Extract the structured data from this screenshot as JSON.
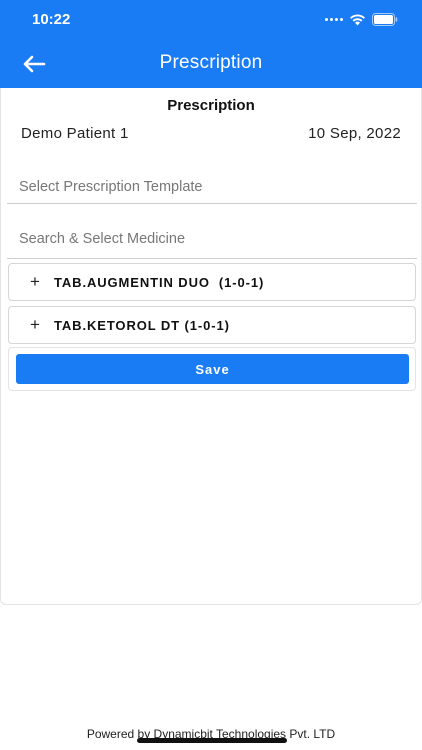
{
  "status_bar": {
    "time": "10:22"
  },
  "app_bar": {
    "title": "Prescription",
    "back_icon": "arrow-left-icon"
  },
  "card": {
    "header": "Prescription",
    "patient_name": "Demo Patient 1",
    "date": "10 Sep, 2022"
  },
  "fields": {
    "template_placeholder": "Select Prescription Template",
    "medicine_placeholder": "Search & Select Medicine"
  },
  "medicines": [
    {
      "icon": "plus",
      "label": "TAB.AUGMENTIN DUO  (1-0-1)"
    },
    {
      "icon": "plus",
      "label": "TAB.KETOROL DT (1-0-1)"
    }
  ],
  "save_label": "Save",
  "footer": "Powered by Dynamicbit Technologies Pvt. LTD",
  "colors": {
    "primary": "#1a7cf5"
  }
}
